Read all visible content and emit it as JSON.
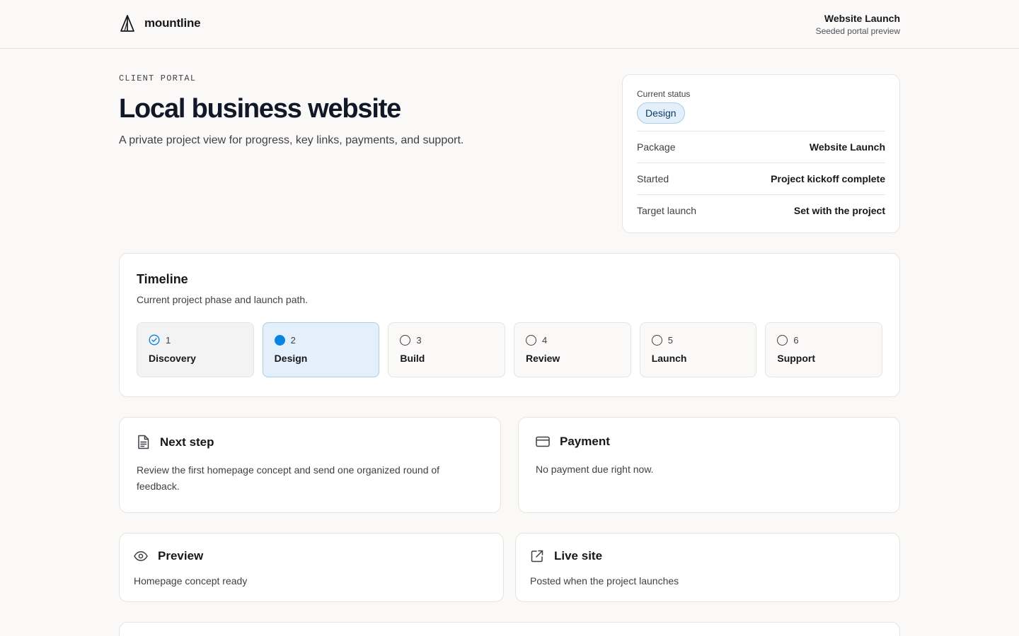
{
  "brand": {
    "name": "mountline",
    "logo_icon": "mountain-logo-icon"
  },
  "project": {
    "title": "Website Launch",
    "subtitle": "Seeded portal preview"
  },
  "hero": {
    "eyebrow": "CLIENT PORTAL",
    "title": "Local business website",
    "description": "A private project view for progress, key links, payments, and support."
  },
  "status": {
    "label": "Current status",
    "value": "Design",
    "rows": [
      {
        "key": "Package",
        "value": "Website Launch"
      },
      {
        "key": "Started",
        "value": "Project kickoff complete"
      },
      {
        "key": "Target launch",
        "value": "Set with the project"
      }
    ]
  },
  "timeline": {
    "title": "Timeline",
    "subtitle": "Current project phase and launch path.",
    "steps": [
      {
        "num": "1",
        "name": "Discovery",
        "state": "done",
        "icon": "check-circle-icon"
      },
      {
        "num": "2",
        "name": "Design",
        "state": "active",
        "icon": "filled-circle-icon"
      },
      {
        "num": "3",
        "name": "Build",
        "state": "upcoming",
        "icon": "empty-circle-icon"
      },
      {
        "num": "4",
        "name": "Review",
        "state": "upcoming",
        "icon": "empty-circle-icon"
      },
      {
        "num": "5",
        "name": "Launch",
        "state": "upcoming",
        "icon": "empty-circle-icon"
      },
      {
        "num": "6",
        "name": "Support",
        "state": "upcoming",
        "icon": "empty-circle-icon"
      }
    ]
  },
  "next_step": {
    "title": "Next step",
    "icon": "document-icon",
    "body": "Review the first homepage concept and send one organized round of feedback."
  },
  "payment": {
    "title": "Payment",
    "icon": "credit-card-icon",
    "body": "No payment due right now."
  },
  "preview": {
    "title": "Preview",
    "icon": "eye-icon",
    "body": "Homepage concept ready"
  },
  "live_site": {
    "title": "Live site",
    "icon": "external-link-icon",
    "body": "Posted when the project launches"
  },
  "colors": {
    "background": "#faf9f7",
    "accent": "#0a84e0",
    "accent_soft": "#e3f0fb",
    "border": "#e7e5e1"
  }
}
